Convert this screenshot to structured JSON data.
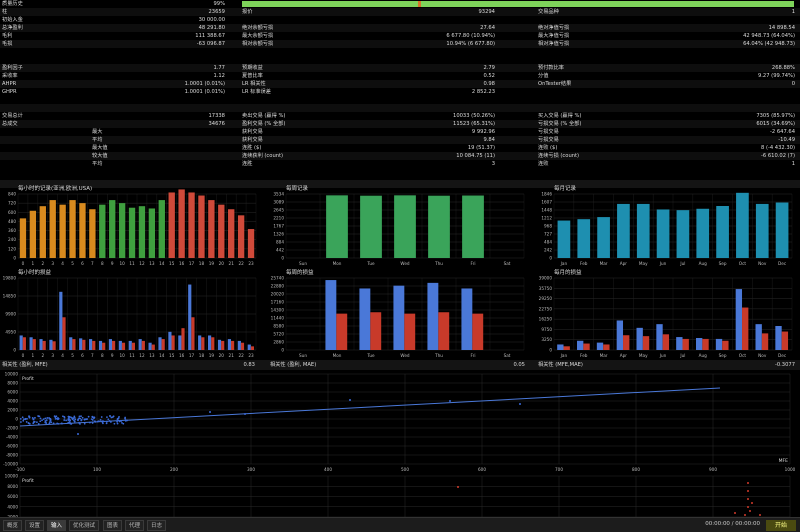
{
  "quality": {
    "label": "质量历史",
    "value": "99%"
  },
  "stats_left": [
    {
      "label": "柱",
      "value": "23659"
    },
    {
      "label": "初始入金",
      "value": "30 000.00"
    },
    {
      "label": "总净盈利",
      "value": "48 291.80"
    },
    {
      "label": "毛利",
      "value": "111 388.67"
    },
    {
      "label": "毛损",
      "value": "-63 096.87"
    },
    {
      "label": "",
      "value": ""
    },
    {
      "label": "盈利因子",
      "value": "1.77"
    },
    {
      "label": "采收率",
      "value": "1.12"
    },
    {
      "label": "AHPR",
      "value": "1.0001 (0.01%)"
    },
    {
      "label": "GHPR",
      "value": "1.0001 (0.01%)"
    },
    {
      "label": "",
      "value": ""
    },
    {
      "label": "交易总计",
      "value": "17338"
    },
    {
      "label": "总成交",
      "value": "34676"
    },
    {
      "label": "最大",
      "value": ""
    },
    {
      "label": "平均",
      "value": ""
    },
    {
      "label": "最大值",
      "value": ""
    },
    {
      "label": "较大值",
      "value": ""
    },
    {
      "label": "平均",
      "value": ""
    }
  ],
  "stats_mid": [
    {
      "label": "报价",
      "value": "93294"
    },
    {
      "label": "",
      "value": ""
    },
    {
      "label": "绝对余额亏损",
      "value": "27.64"
    },
    {
      "label": "最大余额亏损",
      "value": "6 677.80 (10.94%)"
    },
    {
      "label": "相对余额亏损",
      "value": "10.94% (6 677.80)"
    },
    {
      "label": "",
      "value": ""
    },
    {
      "label": "预期收益",
      "value": "2.79"
    },
    {
      "label": "夏普比率",
      "value": "0.52"
    },
    {
      "label": "LR 相关性",
      "value": "0.98"
    },
    {
      "label": "LR 标准误差",
      "value": "2 852.23"
    },
    {
      "label": "",
      "value": ""
    },
    {
      "label": "卖出交易 (赢得 %)",
      "value": "10033 (50.26%)"
    },
    {
      "label": "盈利交易 (% 全部)",
      "value": "11523 (65.31%)"
    },
    {
      "label": "获利交易",
      "value": "9 992.96"
    },
    {
      "label": "获利交易",
      "value": "9.84"
    },
    {
      "label": "连胜 ($)",
      "value": "19 (51.37)"
    },
    {
      "label": "连续获利 (count)",
      "value": "10 084.75 (11)"
    },
    {
      "label": "连胜",
      "value": "3"
    }
  ],
  "stats_right": [
    {
      "label": "交易品种",
      "value": "1"
    },
    {
      "label": "",
      "value": ""
    },
    {
      "label": "绝对净值亏损",
      "value": "14 898.54"
    },
    {
      "label": "最大净值亏损",
      "value": "42 948.73 (64.04%)"
    },
    {
      "label": "相对净值亏损",
      "value": "64.04% (42 948.73)"
    },
    {
      "label": "",
      "value": ""
    },
    {
      "label": "预付款比率",
      "value": "268.88%"
    },
    {
      "label": "分值",
      "value": "9.27 (99.74%)"
    },
    {
      "label": "OnTester结果",
      "value": "0"
    },
    {
      "label": "",
      "value": ""
    },
    {
      "label": "",
      "value": ""
    },
    {
      "label": "买入交易 (赢得 %)",
      "value": "7305 (85.97%)"
    },
    {
      "label": "亏损交易 (% 全部)",
      "value": "6015 (34.69%)"
    },
    {
      "label": "亏损交易",
      "value": "-2 647.64"
    },
    {
      "label": "亏损交易",
      "value": "-10.49"
    },
    {
      "label": "连败 ($)",
      "value": "8 (-4 432.30)"
    },
    {
      "label": "连续亏损 (count)",
      "value": "-6 610.02 (7)"
    },
    {
      "label": "连败",
      "value": "1"
    }
  ],
  "chart_data": [
    {
      "type": "bar",
      "title": "每小时的记录(亚洲,欧洲,USA)",
      "categories": [
        "0",
        "1",
        "2",
        "3",
        "4",
        "5",
        "6",
        "7",
        "8",
        "9",
        "10",
        "11",
        "12",
        "13",
        "14",
        "15",
        "16",
        "17",
        "18",
        "19",
        "20",
        "21",
        "22",
        "23"
      ],
      "values": [
        520,
        620,
        680,
        760,
        700,
        760,
        720,
        640,
        700,
        760,
        720,
        660,
        680,
        650,
        760,
        860,
        900,
        860,
        820,
        760,
        700,
        640,
        560,
        380
      ],
      "colors": [
        "#d88a1e",
        "#d88a1e",
        "#d88a1e",
        "#d88a1e",
        "#d88a1e",
        "#d88a1e",
        "#d88a1e",
        "#d88a1e",
        "#3fa03f",
        "#3fa03f",
        "#3fa03f",
        "#3fa03f",
        "#3fa03f",
        "#3fa03f",
        "#3fa03f",
        "#d04a3a",
        "#d04a3a",
        "#d04a3a",
        "#d04a3a",
        "#d04a3a",
        "#d04a3a",
        "#d04a3a",
        "#d04a3a",
        "#d04a3a"
      ],
      "yticks": [
        "840",
        "720",
        "600",
        "480",
        "360",
        "240",
        "120",
        "0"
      ],
      "ylim": [
        0,
        840
      ]
    },
    {
      "type": "bar",
      "title": "每周记录",
      "categories": [
        "Sun",
        "Mon",
        "Tue",
        "Wed",
        "Thu",
        "Fri",
        "Sat"
      ],
      "values": [
        0,
        3460,
        3440,
        3460,
        3440,
        3450,
        0
      ],
      "color": "#3aa45a",
      "yticks": [
        "3534",
        "3089",
        "2645",
        "2210",
        "1767",
        "1326",
        "884",
        "442",
        "0"
      ],
      "ylim": [
        0,
        3534
      ]
    },
    {
      "type": "bar",
      "title": "每月记录",
      "categories": [
        "Jan",
        "Feb",
        "Mar",
        "Apr",
        "May",
        "Jun",
        "Jul",
        "Aug",
        "Sep",
        "Oct",
        "Nov",
        "Dec"
      ],
      "values": [
        1080,
        1120,
        1180,
        1560,
        1560,
        1400,
        1380,
        1420,
        1500,
        1880,
        1560,
        1600
      ],
      "color": "#1e8fb0",
      "yticks": [
        "1846",
        "1607",
        "1448",
        "1212",
        "968",
        "727",
        "484",
        "242",
        "0"
      ],
      "ylim": [
        0,
        1846
      ]
    },
    {
      "type": "bar",
      "title": "每小时的损益",
      "categories": [
        "0",
        "1",
        "2",
        "3",
        "4",
        "5",
        "6",
        "7",
        "8",
        "9",
        "10",
        "11",
        "12",
        "13",
        "14",
        "15",
        "16",
        "17",
        "18",
        "19",
        "20",
        "21",
        "22",
        "23"
      ],
      "series": [
        {
          "name": "",
          "color": "#4a78d8",
          "values": [
            4000,
            3500,
            3000,
            2800,
            16000,
            3500,
            3200,
            3000,
            2500,
            3000,
            2500,
            2500,
            3000,
            2000,
            3500,
            5000,
            4000,
            18000,
            4000,
            4000,
            2800,
            3000,
            2500,
            1500
          ]
        },
        {
          "name": "",
          "color": "#c83a2a",
          "values": [
            3500,
            3000,
            2500,
            2400,
            9000,
            3000,
            2800,
            2500,
            2000,
            2500,
            2000,
            2000,
            2500,
            1500,
            3000,
            4000,
            6000,
            9000,
            3500,
            3500,
            2500,
            2500,
            2000,
            1000
          ]
        }
      ],
      "yticks": [
        "19800",
        "14850",
        "9900",
        "4950",
        "0"
      ],
      "ylim": [
        0,
        19800
      ]
    },
    {
      "type": "bar",
      "title": "每周的损益",
      "categories": [
        "Sun",
        "Mon",
        "Tue",
        "Wed",
        "Thu",
        "Fri",
        "Sat"
      ],
      "series": [
        {
          "name": "",
          "color": "#4a78d8",
          "values": [
            0,
            25000,
            22000,
            23000,
            24000,
            22000,
            0
          ]
        },
        {
          "name": "",
          "color": "#c83a2a",
          "values": [
            0,
            13000,
            13500,
            13000,
            13500,
            13000,
            0
          ]
        }
      ],
      "yticks": [
        "25740",
        "22880",
        "20020",
        "17160",
        "14300",
        "11440",
        "8580",
        "5720",
        "2860",
        "0"
      ],
      "ylim": [
        0,
        25740
      ]
    },
    {
      "type": "bar",
      "title": "每月的损益",
      "categories": [
        "Jan",
        "Feb",
        "Mar",
        "Apr",
        "May",
        "Jun",
        "Jul",
        "Aug",
        "Sep",
        "Oct",
        "Nov",
        "Dec"
      ],
      "series": [
        {
          "name": "",
          "color": "#4a78d8",
          "values": [
            3000,
            5000,
            4000,
            16000,
            12000,
            14000,
            7000,
            6500,
            6000,
            33000,
            14000,
            13000
          ]
        },
        {
          "name": "",
          "color": "#c83a2a",
          "values": [
            2000,
            3500,
            3000,
            8000,
            7500,
            8500,
            6000,
            6000,
            5000,
            23000,
            9000,
            10000
          ]
        }
      ],
      "yticks": [
        "39000",
        "35750",
        "29250",
        "22750",
        "16250",
        "9750",
        "3250",
        "0"
      ],
      "ylim": [
        0,
        39000
      ]
    }
  ],
  "correlations": [
    {
      "label": "相关性 (盈利, MFE)",
      "value": "0.83"
    },
    {
      "label": "相关性 (盈利, MAE)",
      "value": "0.05"
    },
    {
      "label": "相关性 (MFE,MAE)",
      "value": "-0.3077"
    }
  ],
  "scatter": {
    "title": "Profit",
    "xlabel": "MFE",
    "xticks": [
      "-100",
      "100",
      "200",
      "300",
      "400",
      "500",
      "600",
      "700",
      "800",
      "900",
      "1000"
    ],
    "yticks": [
      "10000",
      "8000",
      "6000",
      "4000",
      "2000",
      "0",
      "-2000",
      "-4000",
      "-6000",
      "-8000",
      "-10000"
    ]
  },
  "scatter2": {
    "title": "Profit",
    "yticks": [
      "10000",
      "8000",
      "6000",
      "4000",
      "2000"
    ]
  },
  "tabs": [
    "概览",
    "设置",
    "输入",
    "优化测试",
    "图表",
    "代理",
    "日志"
  ],
  "active_tab": 2,
  "timer": "00:00:00 / 00:00:00",
  "start_label": "开始"
}
